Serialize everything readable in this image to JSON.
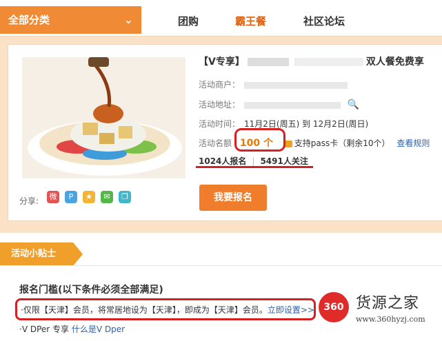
{
  "nav": {
    "category": "全部分类",
    "items": [
      "团购",
      "霸王餐",
      "社区论坛"
    ],
    "active": "霸王餐"
  },
  "product": {
    "title_prefix": "【V专享】",
    "title_suffix": "双人餐免费享",
    "merchant_label": "活动商户：",
    "address_label": "活动地址：",
    "time_label": "活动时间：",
    "time_value": "11月2日(周五) 到 12月2日(周日)",
    "quota_label": "活动名额",
    "quota_value": "100 个",
    "pass_text": "支持pass卡（剩余10个）",
    "rules_link": "查看规则",
    "signups": "1024人报名",
    "followers": "5491人关注",
    "share_label": "分享:",
    "signup_button": "我要报名"
  },
  "tips": {
    "tab": "活动小贴士",
    "heading": "报名门槛(以下条件必须全部满足)",
    "requirement": "·仅限【天津】会员，将常居地设为【天津】，即成为【天津】会员。",
    "setup_link": "立即设置>>",
    "vdper_text": "·V DPer 专享",
    "vdper_link": "什么是V Dper"
  },
  "watermark": {
    "logo": "360",
    "brand": "货源之家",
    "url": "www.360hyzj.com"
  },
  "colors": {
    "accent": "#f08a34",
    "highlight": "#d42020",
    "link": "#2c5fb0"
  }
}
